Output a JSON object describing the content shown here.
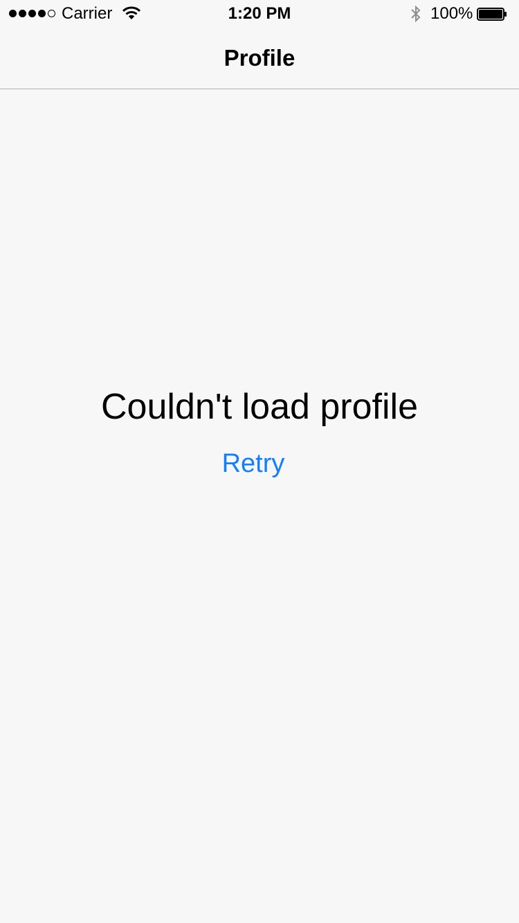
{
  "status_bar": {
    "carrier": "Carrier",
    "time": "1:20 PM",
    "battery_percent": "100%",
    "signal_bars_filled": 4,
    "signal_bars_total": 5,
    "battery_level": 1.0,
    "icons": [
      "signal-dots-icon",
      "wifi-icon",
      "bluetooth-icon",
      "battery-icon"
    ]
  },
  "nav": {
    "title": "Profile"
  },
  "main": {
    "error_message": "Couldn't load profile",
    "retry_label": "Retry"
  },
  "colors": {
    "background": "#f7f7f7",
    "accent": "#147efb",
    "text": "#000000",
    "separator": "#b2b2b2"
  }
}
